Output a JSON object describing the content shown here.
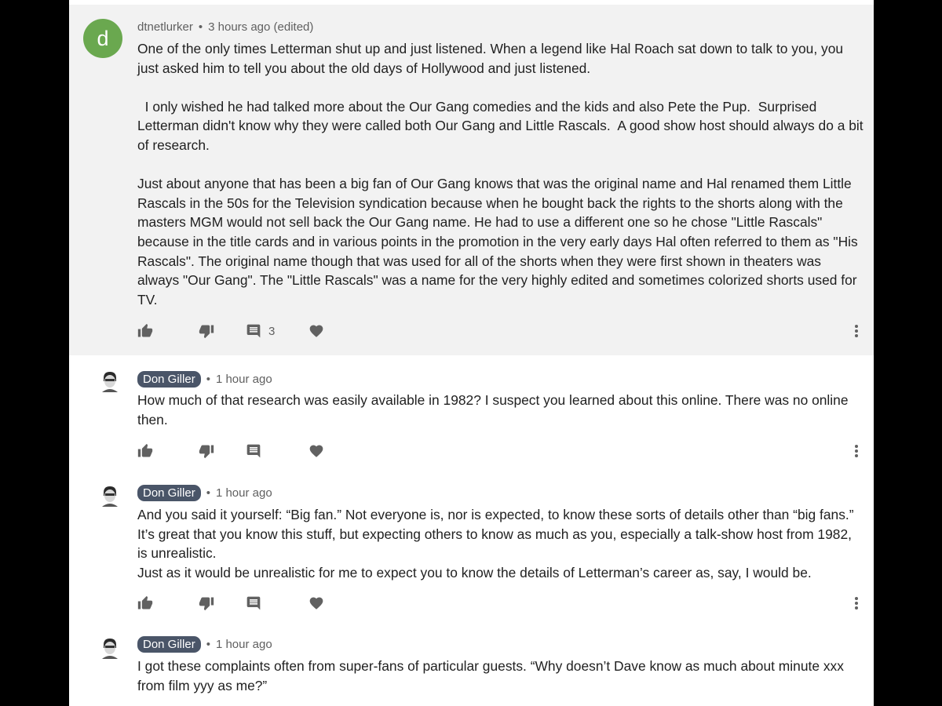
{
  "comments": [
    {
      "author": "dtnetlurker",
      "avatar_letter": "d",
      "time": "3 hours ago (edited)",
      "paragraphs": [
        "One of the only times Letterman shut up and just listened. When a legend like Hal Roach sat down to talk to you, you just asked him to tell you about the old days of Hollywood and just listened.",
        "",
        "  I only wished he had talked more about the Our Gang comedies and the kids and also Pete the Pup.  Surprised Letterman didn't know why they were called both Our Gang and Little Rascals.  A good show host should always do a bit of research.",
        "",
        "Just about anyone that has been a big fan of Our Gang knows that was the original name and Hal renamed them Little Rascals in the 50s for the Television syndication because when he bought back the rights to the shorts along with the masters MGM would not sell back the Our Gang name.  He had to use a different one so he chose \"Little Rascals\" because in the title cards and in various points in the promotion in the very early days Hal often referred to them as \"His Rascals\".  The original name though that was used for all of the shorts when they were first shown in theaters was always \"Our Gang\".  The \"Little Rascals\" was a name for the very highly edited and sometimes colorized shorts used for TV."
      ],
      "reply_count": "3",
      "icons": [
        "thumbs-up-icon",
        "thumbs-down-icon",
        "comment-icon",
        "heart-icon",
        "more-vert-icon"
      ]
    },
    {
      "author": "Don Giller",
      "time": "1 hour ago",
      "paragraphs": [
        "How much of that research was easily available in 1982? I suspect you learned about this online. There was no online then."
      ]
    },
    {
      "author": "Don Giller",
      "time": "1 hour ago",
      "paragraphs": [
        "And you said it yourself: “Big fan.” Not everyone is, nor is expected, to know these sorts of details other than “big fans.” It’s great that you know this stuff, but expecting others to know as much as you, especially a talk-show host from 1982, is unrealistic.",
        "Just as it would be unrealistic for me to expect you to know the details of Letterman’s career as, say, I would be."
      ]
    },
    {
      "author": "Don Giller",
      "time": "1 hour ago",
      "paragraphs": [
        "I got these complaints often from super-fans of particular guests. “Why doesn’t Dave know as much about minute xxx from film yyy as me?”"
      ]
    }
  ],
  "colors": {
    "highlight_bg": "#f2f2f2",
    "avatar_green": "#6aa84f",
    "author_badge_bg": "#4a5568",
    "icon_gray": "#616161"
  }
}
